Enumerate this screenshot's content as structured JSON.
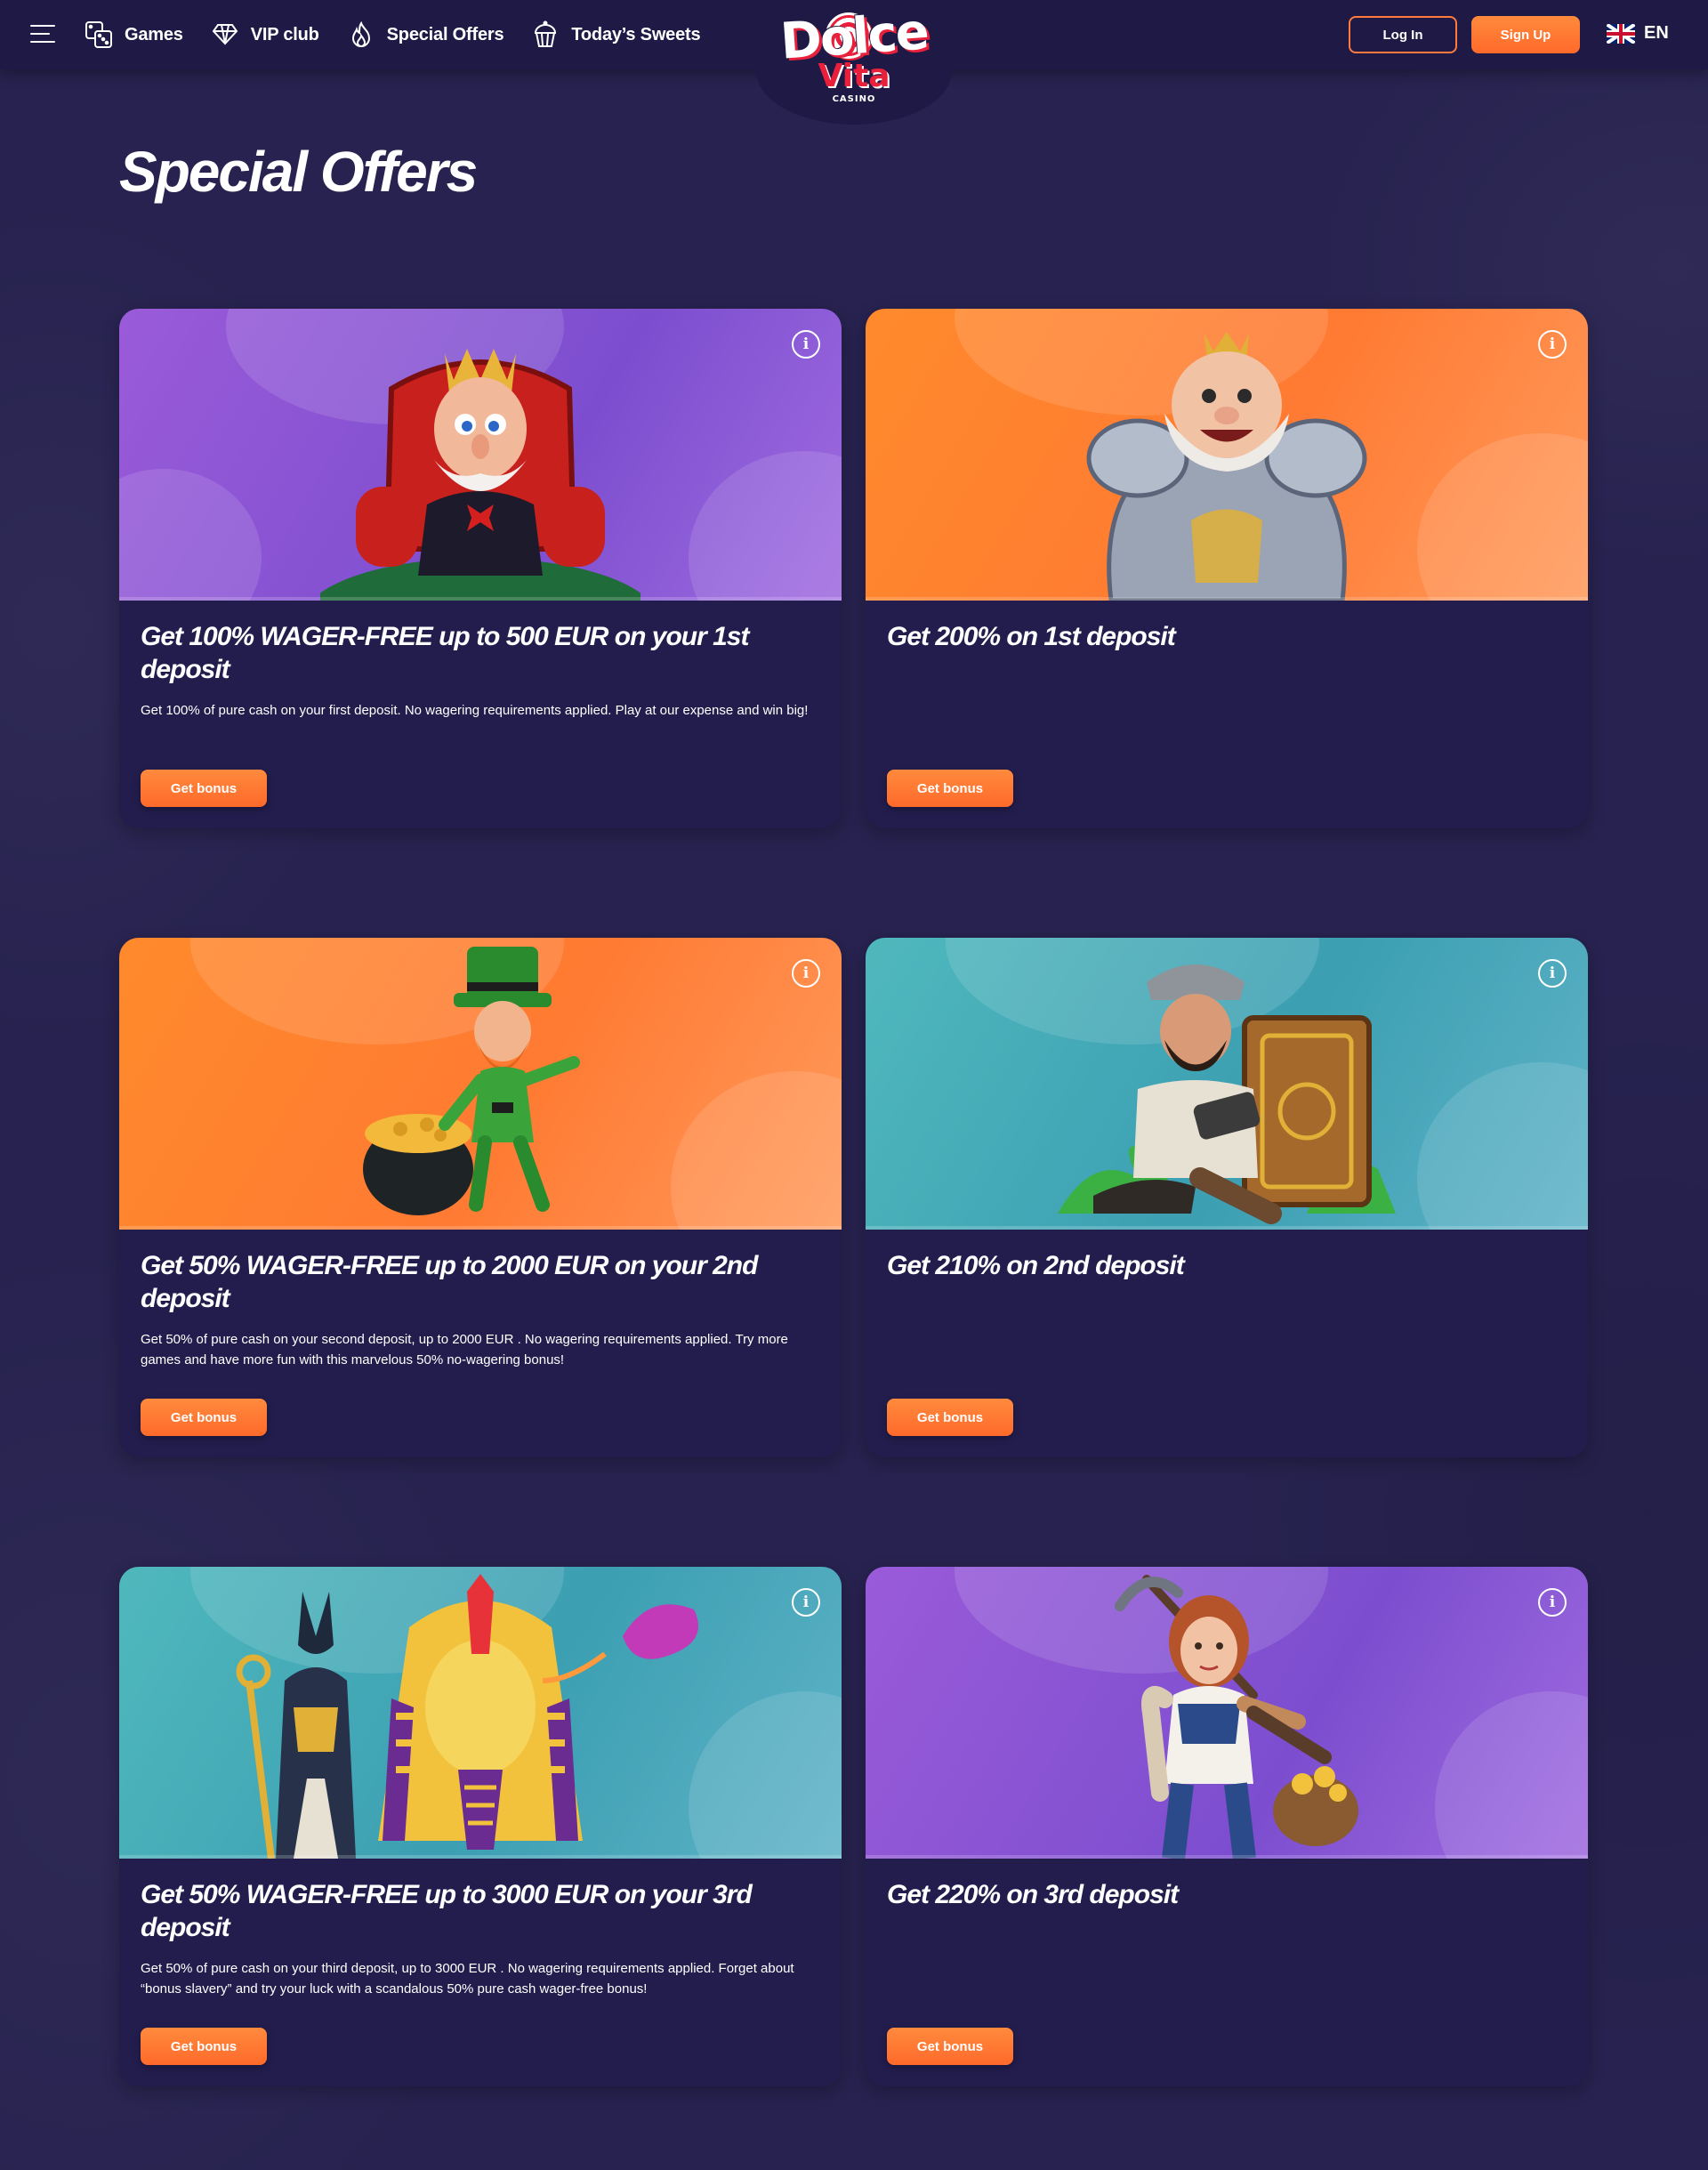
{
  "header": {
    "nav": [
      {
        "label": "Games",
        "icon": "dice-icon"
      },
      {
        "label": "VIP club",
        "icon": "diamond-icon"
      },
      {
        "label": "Special Offers",
        "icon": "flame-icon"
      },
      {
        "label": "Today’s Sweets",
        "icon": "cupcake-icon"
      }
    ],
    "logo": {
      "line1": "Dolce",
      "line2": "Vita",
      "line3": "CASINO"
    },
    "login_label": "Log In",
    "signup_label": "Sign Up",
    "language": "EN"
  },
  "page": {
    "title": "Special Offers"
  },
  "offers": [
    {
      "title": "Get 100% WAGER-FREE up to 500 EUR on your 1st deposit",
      "description": "Get 100% of pure cash on your first deposit. No wagering requirements applied. Play at our expense and win big!",
      "button": "Get bonus",
      "theme": "purple"
    },
    {
      "title": "Get 200% on 1st deposit",
      "description": "",
      "button": "Get bonus",
      "theme": "orange"
    },
    {
      "title": "Get 50% WAGER-FREE up to 2000 EUR on your 2nd deposit",
      "description": "Get 50% of pure cash on your second deposit, up to 2000 EUR . No wagering requirements applied. Try more games and have more fun with this marvelous 50% no-wagering bonus!",
      "button": "Get bonus",
      "theme": "orange"
    },
    {
      "title": "Get 210% on 2nd deposit",
      "description": "",
      "button": "Get bonus",
      "theme": "teal"
    },
    {
      "title": "Get 50% WAGER-FREE up to 3000 EUR on your 3rd deposit",
      "description": "Get 50% of pure cash on your third deposit, up to 3000 EUR . No wagering requirements applied. Forget about “bonus slavery” and try your luck with a scandalous 50% pure cash wager-free bonus!",
      "button": "Get bonus",
      "theme": "teal"
    },
    {
      "title": "Get 220% on 3rd deposit",
      "description": "",
      "button": "Get bonus",
      "theme": "purple"
    }
  ],
  "colors": {
    "background": "#27224f",
    "header": "#1e1a45",
    "card": "#221d4d",
    "accent_orange": "#ff7a3c",
    "purple_banner": "#8a55d6",
    "orange_banner": "#ff822f",
    "teal_banner": "#46aab8"
  }
}
